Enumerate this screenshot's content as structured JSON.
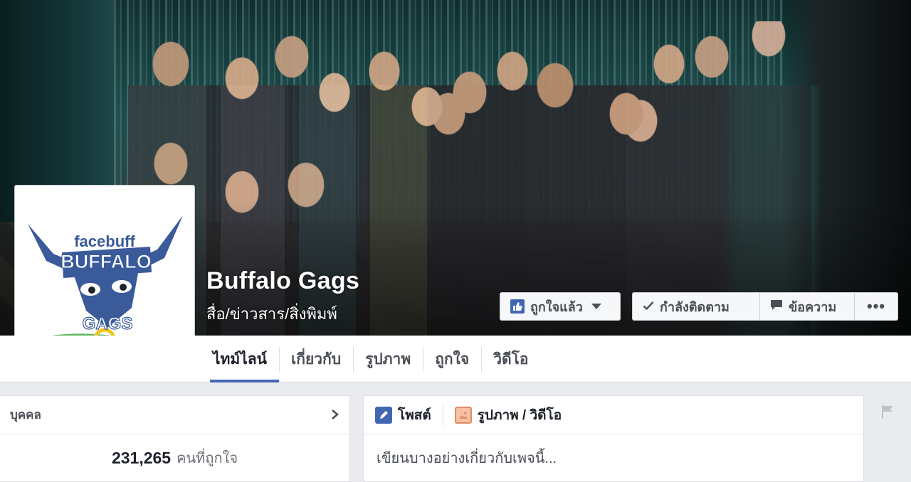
{
  "page": {
    "name": "Buffalo Gags",
    "category": "สื่อ/ข่าวสาร/สิ่งพิมพ์"
  },
  "profile_logo": {
    "text_top": "facebuff",
    "text_mid": "BUFFALO",
    "text_bottom": "GAGS"
  },
  "actions": {
    "like_label": "ถูกใจแล้ว",
    "following_label": "กำลังติดตาม",
    "message_label": "ข้อความ",
    "more_label": "•••"
  },
  "tabs": [
    {
      "label": "ไทม์ไลน์",
      "active": true
    },
    {
      "label": "เกี่ยวกับ",
      "active": false
    },
    {
      "label": "รูปภาพ",
      "active": false
    },
    {
      "label": "ถูกใจ",
      "active": false
    },
    {
      "label": "วิดีโอ",
      "active": false
    }
  ],
  "people_card": {
    "title": "บุคคล",
    "likes_count": "231,265",
    "likes_label": "คนที่ถูกใจ"
  },
  "composer": {
    "post_tab": "โพสต์",
    "photo_tab": "รูปภาพ / วิดีโอ",
    "placeholder": "เขียนบางอย่างเกี่ยวกับเพจนี้..."
  },
  "colors": {
    "accent": "#4267b2",
    "logo_blue": "#3a5a9a",
    "logo_green": "#5cb85c",
    "logo_gold": "#f0c419"
  }
}
